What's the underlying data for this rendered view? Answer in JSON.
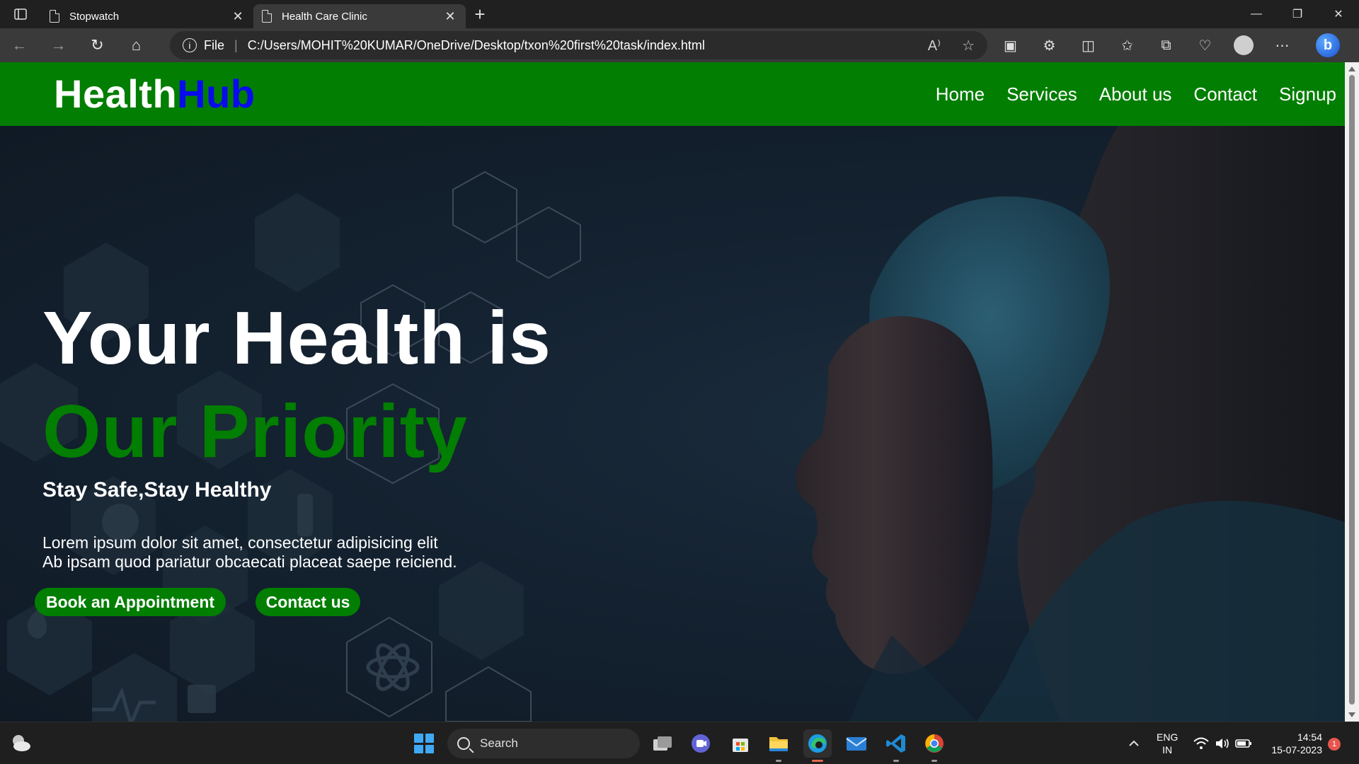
{
  "browser": {
    "tabs": [
      {
        "title": "Stopwatch",
        "active": false
      },
      {
        "title": "Health Care Clinic",
        "active": true
      }
    ],
    "address": {
      "scheme_label": "File",
      "url": "C:/Users/MOHIT%20KUMAR/OneDrive/Desktop/txon%20first%20task/index.html"
    }
  },
  "site": {
    "logo": {
      "part1": "Health",
      "part2": "Hub"
    },
    "nav": [
      "Home",
      "Services",
      "About us",
      "Contact",
      "Signup"
    ],
    "hero": {
      "title_line1": "Your Health is",
      "title_line2": "Our Priority",
      "subtitle": "Stay Safe,Stay Healthy",
      "text_line1": "Lorem ipsum dolor sit amet, consectetur adipisicing elit",
      "text_line2": "Ab ipsam quod pariatur obcaecati placeat saepe reiciend.",
      "btn_book": "Book an Appointment",
      "btn_contact": "Contact us"
    },
    "colors": {
      "brand_green": "#027e02",
      "logo_blue": "#0a0aee",
      "hero_dark": "#142231"
    }
  },
  "taskbar": {
    "search_placeholder": "Search",
    "lang_line1": "ENG",
    "lang_line2": "IN",
    "time": "14:54",
    "date": "15-07-2023",
    "notification_count": "1"
  }
}
